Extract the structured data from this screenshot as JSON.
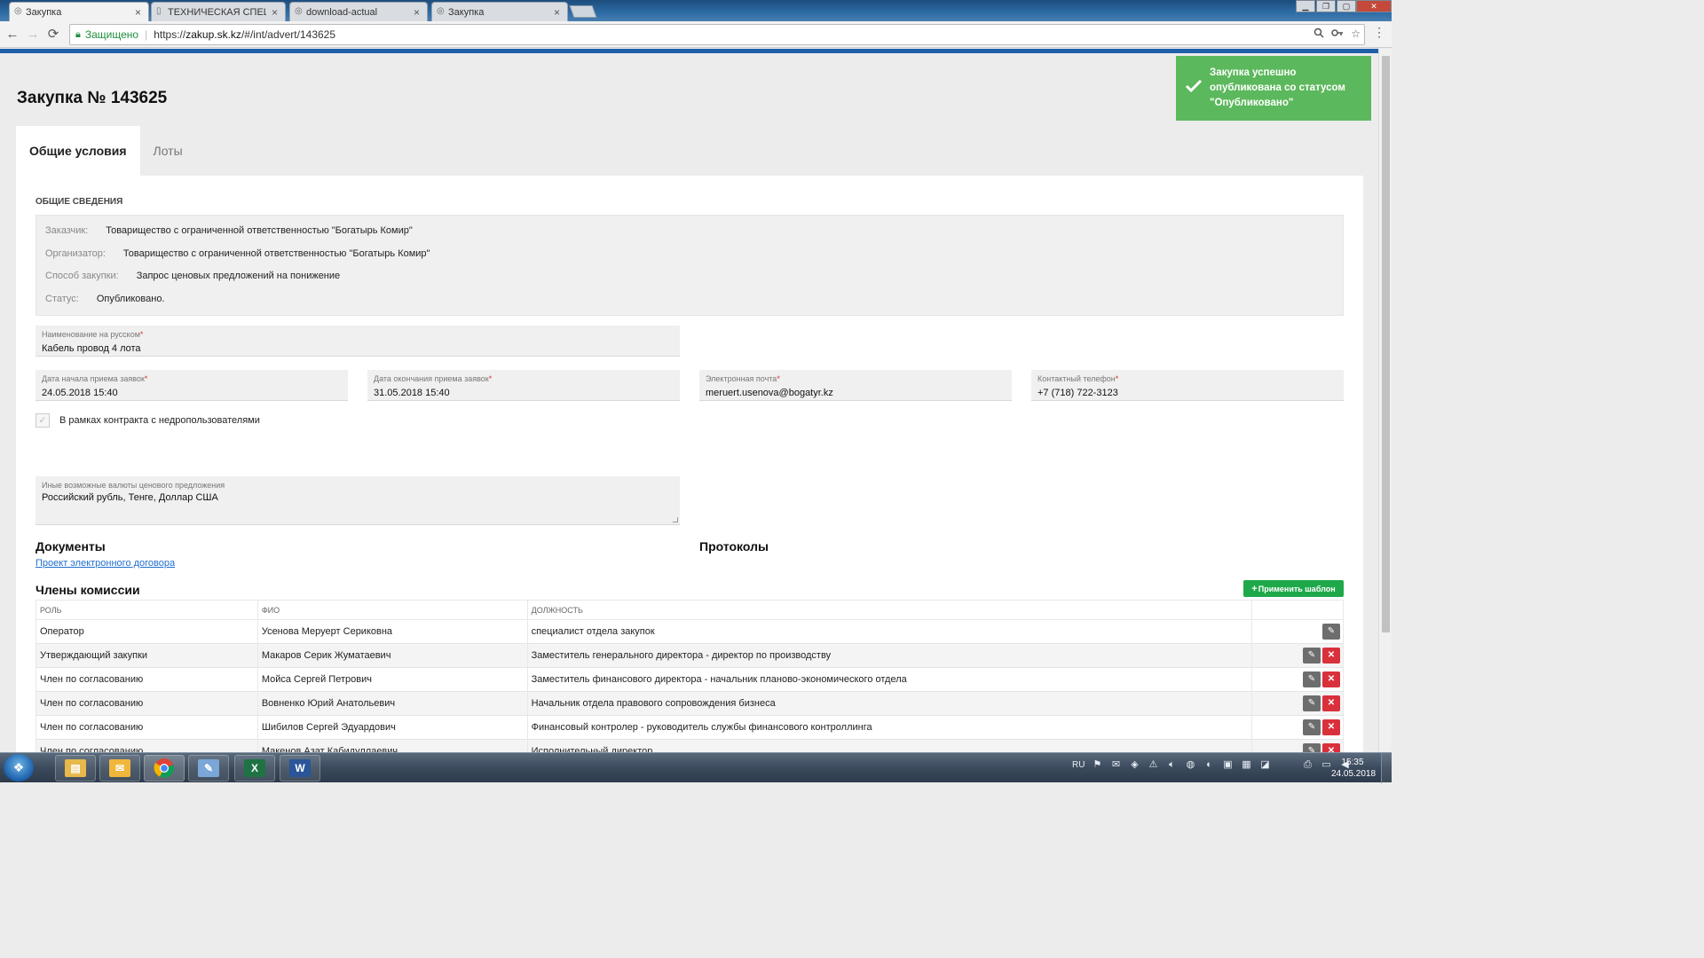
{
  "browser": {
    "tabs": [
      {
        "title": "Закупка",
        "active": true
      },
      {
        "title": "ТЕХНИЧЕСКАЯ СПЕЦИФ",
        "active": false
      },
      {
        "title": "download-actual",
        "active": false
      },
      {
        "title": "Закупка",
        "active": false
      }
    ],
    "tab_close": "×",
    "secure_label": "Защищено",
    "url_scheme": "https://",
    "url_host": "zakup.sk.kz",
    "url_path": "/#/int/advert/143625",
    "nav_icons": {
      "back": "←",
      "forward": "→",
      "reload": "⟳"
    },
    "omnibox_icons": {
      "zoom": "zoom-icon",
      "key": "key-icon",
      "star": "☆"
    }
  },
  "page": {
    "title": "Закупка № 143625",
    "tabs": [
      "Общие условия",
      "Лоты"
    ],
    "general": {
      "section_title": "ОБЩИЕ СВЕДЕНИЯ",
      "rows": [
        {
          "label": "Заказчик:",
          "value": "Товарищество с ограниченной ответственностью \"Богатырь Комир\""
        },
        {
          "label": "Организатор:",
          "value": "Товарищество с ограниченной ответственностью \"Богатырь Комир\""
        },
        {
          "label": "Способ закупки:",
          "value": "Запрос ценовых предложений на понижение"
        },
        {
          "label": "Статус:",
          "value": "Опубликовано."
        }
      ]
    },
    "fields": {
      "name_ru": {
        "label": "Наименование на русском",
        "value": "Кабель провод 4 лота"
      },
      "start_date": {
        "label": "Дата начала приема заявок",
        "value": "24.05.2018 15:40"
      },
      "end_date": {
        "label": "Дата окончания приема заявок",
        "value": "31.05.2018 15:40"
      },
      "email": {
        "label": "Электронная почта",
        "value": "meruert.usenova@bogatyr.kz"
      },
      "phone": {
        "label": "Контактный телефон",
        "value": "+7 (718) 722-3123"
      },
      "required_mark": "*",
      "subsoil_checkbox_label": "В рамках контракта с недропользователями",
      "currencies": {
        "label": "Иные возможные валюты ценового предложения",
        "value": "Российский  рубль, Тенге, Доллар США"
      }
    },
    "documents": {
      "title": "Документы",
      "link": "Проект электронного договора"
    },
    "protocols": {
      "title": "Протоколы"
    },
    "commission": {
      "title": "Члены комиссии",
      "apply_template_label": "Применить шаблон",
      "columns": [
        "РОЛЬ",
        "ФИО",
        "ДОЛЖНОСТЬ"
      ],
      "rows": [
        {
          "role": "Оператор",
          "name": "Усенова Меруерт Сериковна",
          "position": "специалист отдела закупок",
          "deletable": false
        },
        {
          "role": "Утверждающий закупки",
          "name": "Макаров Серик Жуматаевич",
          "position": "Заместитель генерального директора - директор по производству",
          "deletable": true
        },
        {
          "role": "Член по согласованию",
          "name": "Мойса Сергей Петрович",
          "position": "Заместитель финансового директора - начальник планово-экономического отдела",
          "deletable": true
        },
        {
          "role": "Член по согласованию",
          "name": "Вовненко Юрий Анатольевич",
          "position": "Начальник отдела правового сопровождения бизнеса",
          "deletable": true
        },
        {
          "role": "Член по согласованию",
          "name": "Шибилов Сергей Эдуардович",
          "position": "Финансовый контролер - руководитель службы финансового контроллинга",
          "deletable": true
        },
        {
          "role": "Член по согласованию",
          "name": "Макенов Азат Кабидуллаевич",
          "position": "Исполнительный директор",
          "deletable": true
        }
      ]
    }
  },
  "toast": {
    "message": "Закупка успешно опубликована со статусом \"Опубликовано\""
  },
  "taskbar": {
    "language": "RU",
    "time": "15:35",
    "date": "24.05.2018",
    "apps": [
      "explorer",
      "outlook",
      "chrome",
      "notes",
      "excel",
      "word"
    ]
  },
  "colors": {
    "toast_green": "#5cb85c",
    "apply_green": "#1fa84a",
    "delete_red": "#d9313b",
    "link_blue": "#1f6fd1",
    "header_blue": "#1f5fa9"
  }
}
